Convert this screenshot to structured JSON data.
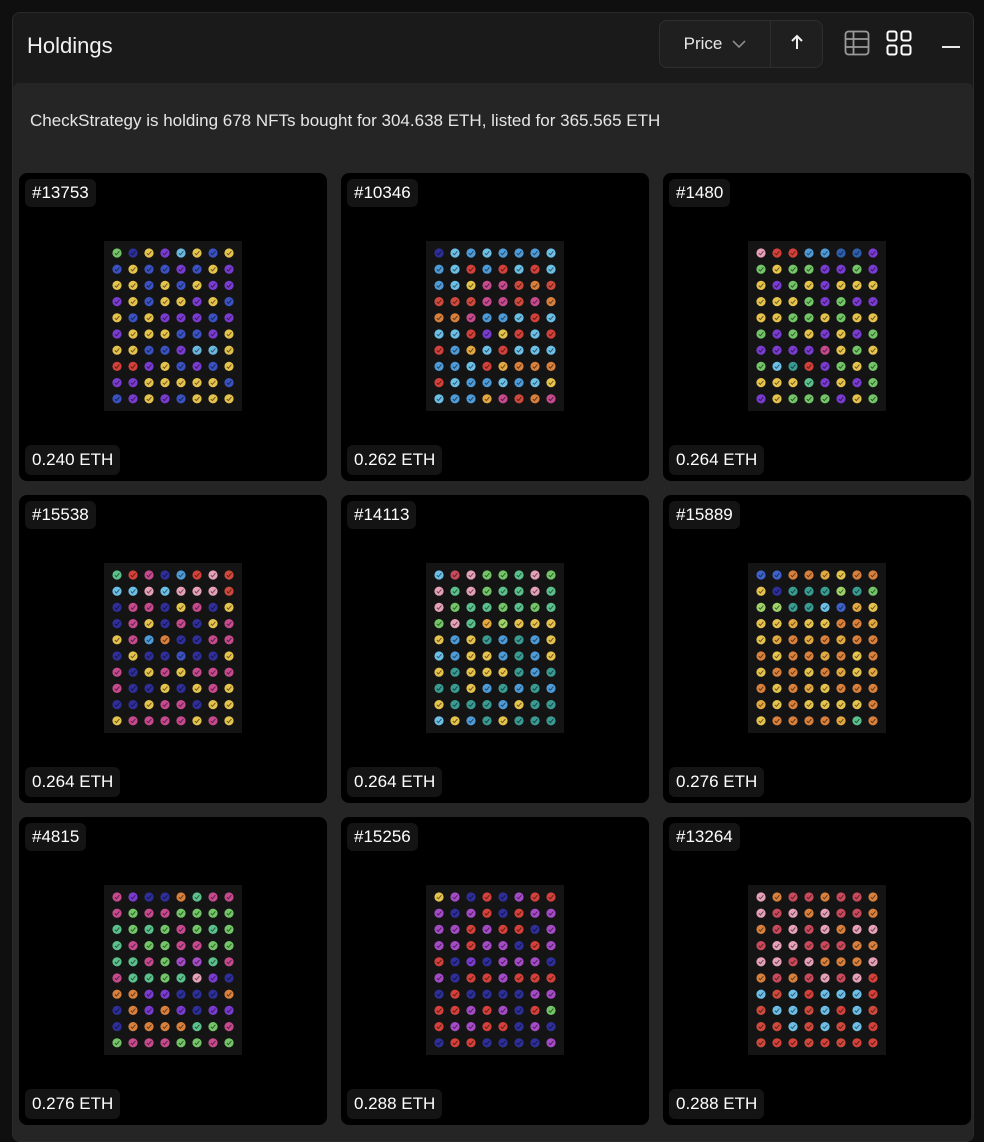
{
  "panel": {
    "title": "Holdings"
  },
  "toolbar": {
    "sort_label": "Price",
    "sort_direction": "ascending",
    "view_table_icon": "table-grid-icon",
    "view_gallery_icon": "gallery-grid-icon",
    "collapse_icon": "minus-icon"
  },
  "summary": {
    "text": "CheckStrategy is holding 678 NFTs bought for 304.638 ETH, listed for 365.565 ETH"
  },
  "nfts": [
    {
      "id": "#13753",
      "price": "0.240 ETH",
      "palette": [
        "#3a52c2",
        "#c24b8c",
        "#e0c04a",
        "#d8813a",
        "#7a3bd1",
        "#2e2f9a",
        "#d4413a",
        "#a64bc7",
        "#e6c34c",
        "#73c667",
        "#c84a5c",
        "#6bb8e0"
      ]
    },
    {
      "id": "#10346",
      "price": "0.262 ETH",
      "palette": [
        "#6cc0e8",
        "#3d62c9",
        "#d9803c",
        "#e6c34c",
        "#d4413a",
        "#2e2f9a",
        "#c74a8e",
        "#7a3bd1",
        "#4e9bd8",
        "#a64bc7",
        "#cf4a3d",
        "#e3a940"
      ]
    },
    {
      "id": "#1480",
      "price": "0.264 ETH",
      "palette": [
        "#e6c34c",
        "#d9803c",
        "#d4413a",
        "#6cc0e8",
        "#73c667",
        "#3a9b92",
        "#4e9bd8",
        "#c74a8e",
        "#7a3bd1",
        "#2e5fae",
        "#e6a0b8",
        "#5bc18c"
      ]
    },
    {
      "id": "#15538",
      "price": "0.264 ETH",
      "palette": [
        "#e6c34c",
        "#d4413a",
        "#6cc0e8",
        "#3a52c2",
        "#c74a8e",
        "#73c667",
        "#e6a0b8",
        "#d9803c",
        "#2e2f9a",
        "#5bc18c",
        "#cf4a3d",
        "#4e9bd8"
      ]
    },
    {
      "id": "#14113",
      "price": "0.264 ETH",
      "palette": [
        "#e6c34c",
        "#d9803c",
        "#73c667",
        "#6cc0e8",
        "#3a9b92",
        "#e3a940",
        "#5bc18c",
        "#c84a5c",
        "#4e9bd8",
        "#9fd36a",
        "#e6a0b8",
        "#3d62c9"
      ]
    },
    {
      "id": "#15889",
      "price": "0.276 ETH",
      "palette": [
        "#e6c34c",
        "#6cc0e8",
        "#3a9b92",
        "#4e9bd8",
        "#d9803c",
        "#2e5fae",
        "#73c667",
        "#5bc18c",
        "#e3a940",
        "#3d62c9",
        "#9fd36a",
        "#2e2f9a"
      ]
    },
    {
      "id": "#4815",
      "price": "0.276 ETH",
      "palette": [
        "#73c667",
        "#6cc0e8",
        "#7a3bd1",
        "#e6a0b8",
        "#c74a8e",
        "#3a52c2",
        "#2e2f9a",
        "#a64bc7",
        "#5bc18c",
        "#4e9bd8",
        "#d9803c",
        "#3a9b92"
      ]
    },
    {
      "id": "#15256",
      "price": "0.288 ETH",
      "palette": [
        "#d4413a",
        "#e6c34c",
        "#c74a8e",
        "#6cc0e8",
        "#2e2f9a",
        "#3d62c9",
        "#d9803c",
        "#73c667",
        "#a64bc7",
        "#e6a0b8",
        "#4e9bd8",
        "#7a3bd1"
      ]
    },
    {
      "id": "#13264",
      "price": "0.288 ETH",
      "palette": [
        "#d4413a",
        "#e6c34c",
        "#d9803c",
        "#e3a940",
        "#cf4a3d",
        "#5bc18c",
        "#c84a5c",
        "#9fd36a",
        "#6cc0e8",
        "#a63a32",
        "#e6a0b8",
        "#73c667"
      ]
    }
  ],
  "colors": {
    "background": "#0f0f0f",
    "panel": "#1a1a1a",
    "content": "#252525",
    "card": "#000000",
    "text": "#ffffff"
  }
}
